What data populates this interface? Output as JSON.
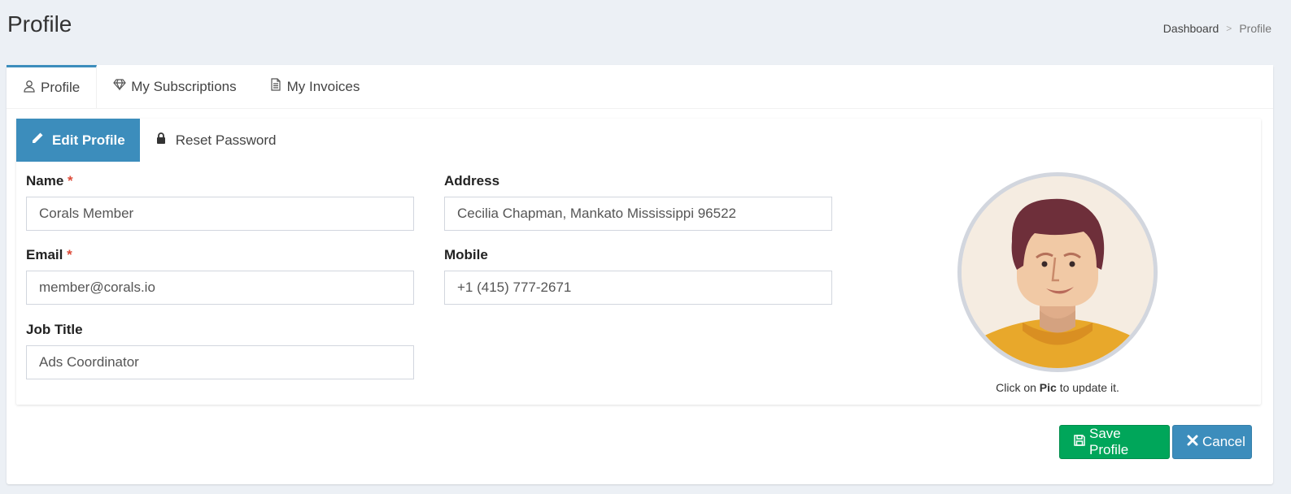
{
  "header": {
    "title": "Profile",
    "breadcrumb": [
      "Dashboard",
      "Profile"
    ],
    "separator": ">"
  },
  "tabs": [
    {
      "label": "Profile",
      "icon": "user-icon",
      "active": true
    },
    {
      "label": "My Subscriptions",
      "icon": "diamond-icon",
      "active": false
    },
    {
      "label": "My Invoices",
      "icon": "document-icon",
      "active": false
    }
  ],
  "subtabs": [
    {
      "label": "Edit Profile",
      "icon": "pencil-icon",
      "active": true
    },
    {
      "label": "Reset Password",
      "icon": "lock-icon",
      "active": false
    }
  ],
  "form": {
    "name": {
      "label": "Name",
      "required": "*",
      "value": "Corals Member"
    },
    "email": {
      "label": "Email",
      "required": "*",
      "value": "member@corals.io"
    },
    "job_title": {
      "label": "Job Title",
      "value": "Ads Coordinator"
    },
    "address": {
      "label": "Address",
      "value": "Cecilia Chapman, Mankato Mississippi 96522"
    },
    "mobile": {
      "label": "Mobile",
      "value": "+1 (415) 777-2671"
    }
  },
  "avatar": {
    "hint_prefix": "Click on",
    "hint_bold": "Pic",
    "hint_suffix": "to update it."
  },
  "actions": {
    "save_label": "Save Profile",
    "cancel_label": "Cancel"
  },
  "colors": {
    "primary": "#3c8dbc",
    "success": "#00a65a",
    "required": "#dd4b39",
    "background": "#ecf0f5"
  }
}
